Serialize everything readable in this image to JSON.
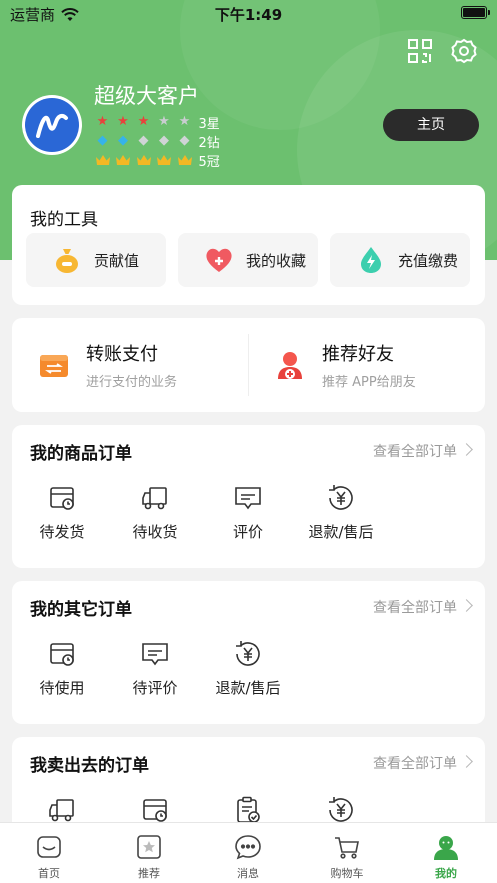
{
  "status_bar": {
    "carrier": "运营商",
    "time": "下午1:49"
  },
  "profile": {
    "name": "超级大客户",
    "stars_label": "3星",
    "diamonds_label": "2钻",
    "crowns_label": "5冠",
    "stars": 3,
    "diamonds": 2,
    "crowns": 5,
    "home_button": "主页"
  },
  "tools": {
    "title": "我的工具",
    "items": [
      {
        "label": "贡献值",
        "icon": "money-bag-icon"
      },
      {
        "label": "我的收藏",
        "icon": "heart-icon"
      },
      {
        "label": "充值缴费",
        "icon": "drop-bolt-icon"
      }
    ]
  },
  "pay": {
    "transfer_title": "转账支付",
    "transfer_sub": "进行支付的业务",
    "recommend_title": "推荐好友",
    "recommend_sub": "推荐 APP给朋友"
  },
  "product_orders": {
    "title": "我的商品订单",
    "see_all": "查看全部订单",
    "items": [
      "待发货",
      "待收货",
      "评价",
      "退款/售后"
    ]
  },
  "other_orders": {
    "title": "我的其它订单",
    "see_all": "查看全部订单",
    "items": [
      "待使用",
      "待评价",
      "退款/售后"
    ]
  },
  "sold_orders": {
    "title": "我卖出去的订单",
    "see_all": "查看全部订单"
  },
  "tabbar": {
    "items": [
      "首页",
      "推荐",
      "消息",
      "购物车",
      "我的"
    ],
    "active": "我的"
  },
  "colors": {
    "brand_green": "#6cc06f",
    "active_tab": "#3aa64a",
    "star": "#e8423c",
    "diamond": "#36b3ea",
    "crown": "#f3b824"
  }
}
